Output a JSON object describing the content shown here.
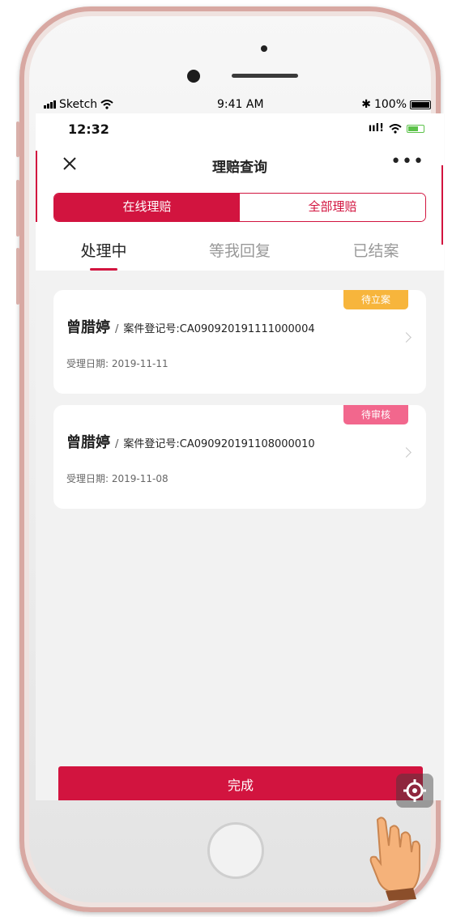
{
  "sketch_status": {
    "carrier": "Sketch",
    "time": "9:41 AM",
    "battery": "100%"
  },
  "app_status": {
    "time": "12:32"
  },
  "nav": {
    "title": "理赔查询",
    "more": "•••"
  },
  "segments": {
    "online": "在线理赔",
    "all": "全部理赔",
    "selected": "online"
  },
  "tabs": [
    {
      "label": "处理中",
      "active": true
    },
    {
      "label": "等我回复",
      "active": false
    },
    {
      "label": "已结案",
      "active": false
    }
  ],
  "claims": [
    {
      "badge": "待立案",
      "badge_color": "#f7b53c",
      "name": "曾腊婷",
      "separator": "/",
      "case_label": "案件登记号:CA090920191111000004",
      "date_label": "受理日期:  2019-11-11"
    },
    {
      "badge": "待审核",
      "badge_color": "#f2678d",
      "name": "曾腊婷",
      "separator": "/",
      "case_label": "案件登记号:CA090920191108000010",
      "date_label": "受理日期:  2019-11-08"
    }
  ],
  "actions": {
    "done": "完成"
  },
  "colors": {
    "accent": "#d2143f",
    "background": "#f2f2f2"
  }
}
